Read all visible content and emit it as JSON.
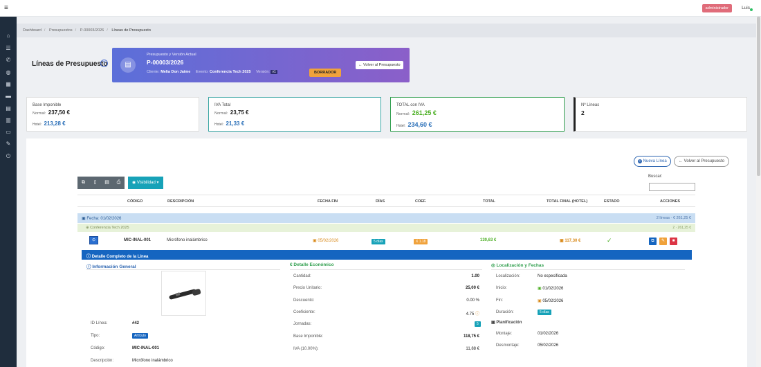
{
  "topbar": {
    "role_badge": "administrador",
    "user": "Luis"
  },
  "breadcrumb": [
    "Dashboard",
    "Presupuestos",
    "P-00003/2026",
    "Líneas de Presupuesto"
  ],
  "page": {
    "title": "Líneas de Presupuesto"
  },
  "banner": {
    "subtitle": "Presupuesto y Versión Actual",
    "code": "P-00003/2026",
    "client_label": "Cliente:",
    "client": "Melia Don Jaime",
    "event_label": "Evento:",
    "event": "Conferencia Tech 2025",
    "version_label": "Versión:",
    "version": "v1",
    "status": "BORRADOR",
    "back_button": "Volver al Presupuesto"
  },
  "cards": {
    "base": {
      "title": "Base Imponible",
      "normal_label": "Normal:",
      "normal": "237,50 €",
      "hotel_label": "Hotel:",
      "hotel": "213,28 €"
    },
    "iva": {
      "title": "IVA Total",
      "normal_label": "Normal:",
      "normal": "23,75 €",
      "hotel_label": "Hotel:",
      "hotel": "21,33 €"
    },
    "total": {
      "title": "TOTAL con IVA",
      "normal_label": "Normal:",
      "normal": "261,25 €",
      "hotel_label": "Hotel:",
      "hotel": "234,60 €"
    },
    "lines": {
      "title": "Nº Líneas",
      "value": "2"
    }
  },
  "toolbar": {
    "new_line": "Nueva Línea",
    "back": "Volver al Presupuesto",
    "search_label": "Buscar:",
    "visibility": "Visibilidad"
  },
  "table": {
    "headers": {
      "codigo": "CÓDIGO",
      "descripcion": "DESCRIPCIÓN",
      "fecha_fin": "FECHA FIN",
      "dias": "DÍAS",
      "coef": "COEF.",
      "total": "TOTAL",
      "total_final": "TOTAL FINAL (HOTEL)",
      "estado": "ESTADO",
      "acciones": "ACCIONES"
    },
    "group_date": {
      "label": "Fecha: 01/02/2026",
      "summary": "2 líneas · € 261,25 €"
    },
    "group_event": {
      "label": "Conferencia Tech 2025",
      "summary": "2 · 261,25 €"
    },
    "row": {
      "codigo": "MIC-INAL-001",
      "descripcion": "Micrófono inalámbrico",
      "fecha_fin": "05/02/2026",
      "dias": "5 días",
      "coef": "X 1.18",
      "total": "130,63 €",
      "total_final": "117,30 €"
    }
  },
  "detail": {
    "header": "Detalle Completo de la Línea",
    "general": {
      "title": "Información General",
      "id_label": "ID Línea:",
      "id": "#42",
      "tipo_label": "Tipo:",
      "tipo": "Artículo",
      "codigo_label": "Código:",
      "codigo": "MIC-INAL-001",
      "desc_label": "Descripción:",
      "desc": "Micrófono inalámbrico"
    },
    "economico": {
      "title": "Detalle Económico",
      "cantidad_label": "Cantidad:",
      "cantidad": "1.00",
      "precio_label": "Precio Unitario:",
      "precio": "25,00 €",
      "descuento_label": "Descuento:",
      "descuento": "0.00 %",
      "coef_label": "Coeficiente:",
      "coef": "4.75",
      "jornadas_label": "Jornadas:",
      "jornadas": "5",
      "base_label": "Base Imponible:",
      "base": "118,75 €",
      "iva_label": "IVA (10.00%):",
      "iva": "11,88 €"
    },
    "localizacion": {
      "title": "Localización y Fechas",
      "loc_label": "Localización:",
      "loc": "No especificada",
      "inicio_label": "Inicio:",
      "inicio": "01/02/2026",
      "fin_label": "Fin:",
      "fin": "05/02/2026",
      "duracion_label": "Duración:",
      "duracion": "5 días",
      "plan_title": "Planificación",
      "montaje_label": "Montaje:",
      "montaje": "01/02/2026",
      "desmontaje_label": "Desmontaje:",
      "desmontaje": "05/02/2026"
    }
  },
  "colors": {
    "primary": "#1565c0",
    "success": "#4caf24",
    "warning": "#f0a23b",
    "danger": "#dc3545",
    "info": "#17a2b8"
  }
}
